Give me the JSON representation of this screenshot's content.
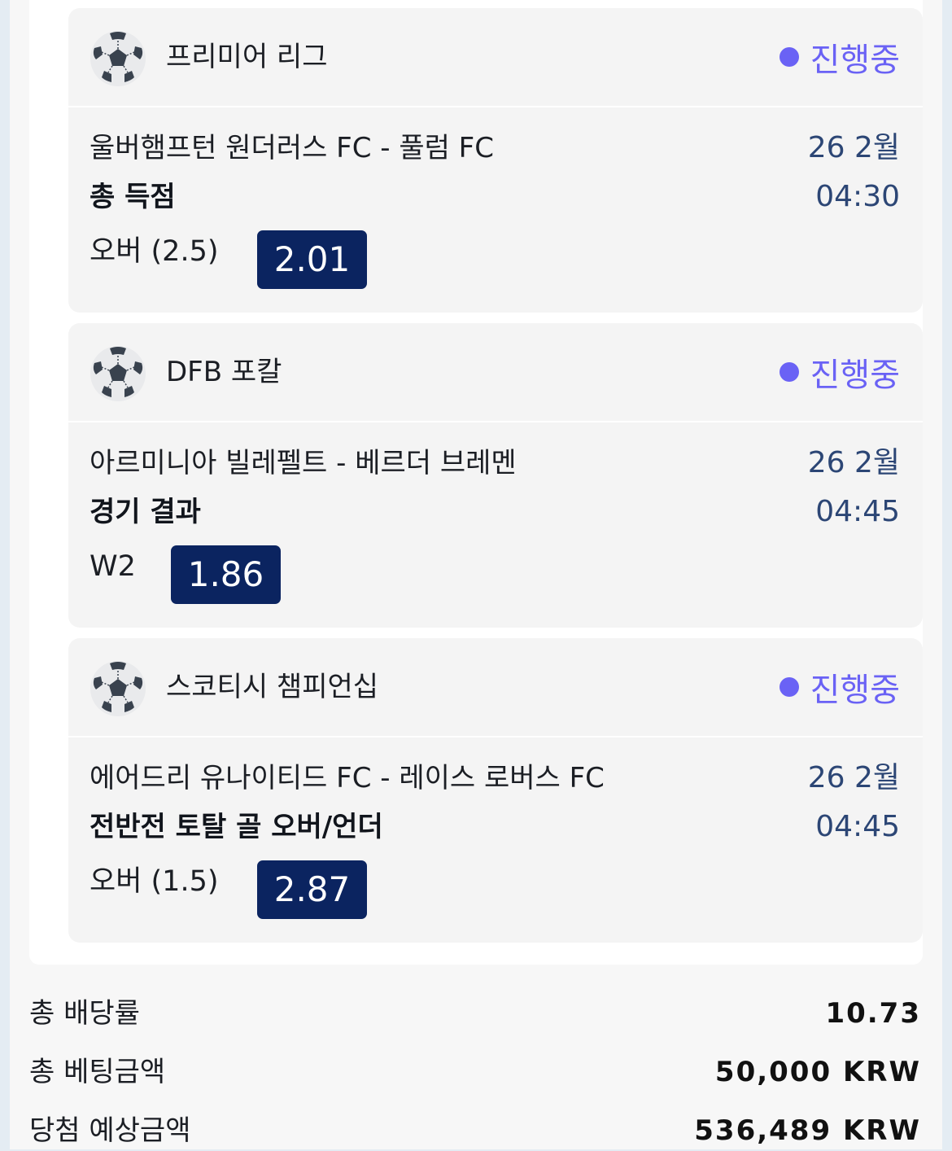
{
  "bets": [
    {
      "league": "프리미어 리그",
      "status": "진행중",
      "match": "울버햄프턴 원더러스 FC - 풀럼 FC",
      "date": "26 2월",
      "time": "04:30",
      "market": "총 득점",
      "pick": "오버 (2.5)",
      "odds": "2.01",
      "icon": "soccer-ball-icon"
    },
    {
      "league": "DFB 포칼",
      "status": "진행중",
      "match": "아르미니아 빌레펠트 - 베르더 브레멘",
      "date": "26 2월",
      "time": "04:45",
      "market": "경기 결과",
      "pick": "W2",
      "odds": "1.86",
      "icon": "soccer-ball-icon"
    },
    {
      "league": "스코티시 챔피언십",
      "status": "진행중",
      "match": "에어드리 유나이티드 FC - 레이스 로버스 FC",
      "date": "26 2월",
      "time": "04:45",
      "market": "전반전 토탈 골 오버/언더",
      "pick": "오버 (1.5)",
      "odds": "2.87",
      "icon": "soccer-ball-icon"
    }
  ],
  "summary": {
    "total_odds_label": "총 배당률",
    "total_odds_value": "10.73",
    "stake_label": "총 베팅금액",
    "stake_value": "50,000 KRW",
    "payout_label": "당첨 예상금액",
    "payout_value": "536,489 KRW"
  },
  "colors": {
    "live": "#6a62f5",
    "odds_bg": "#0b2460",
    "date_text": "#2c4675"
  }
}
